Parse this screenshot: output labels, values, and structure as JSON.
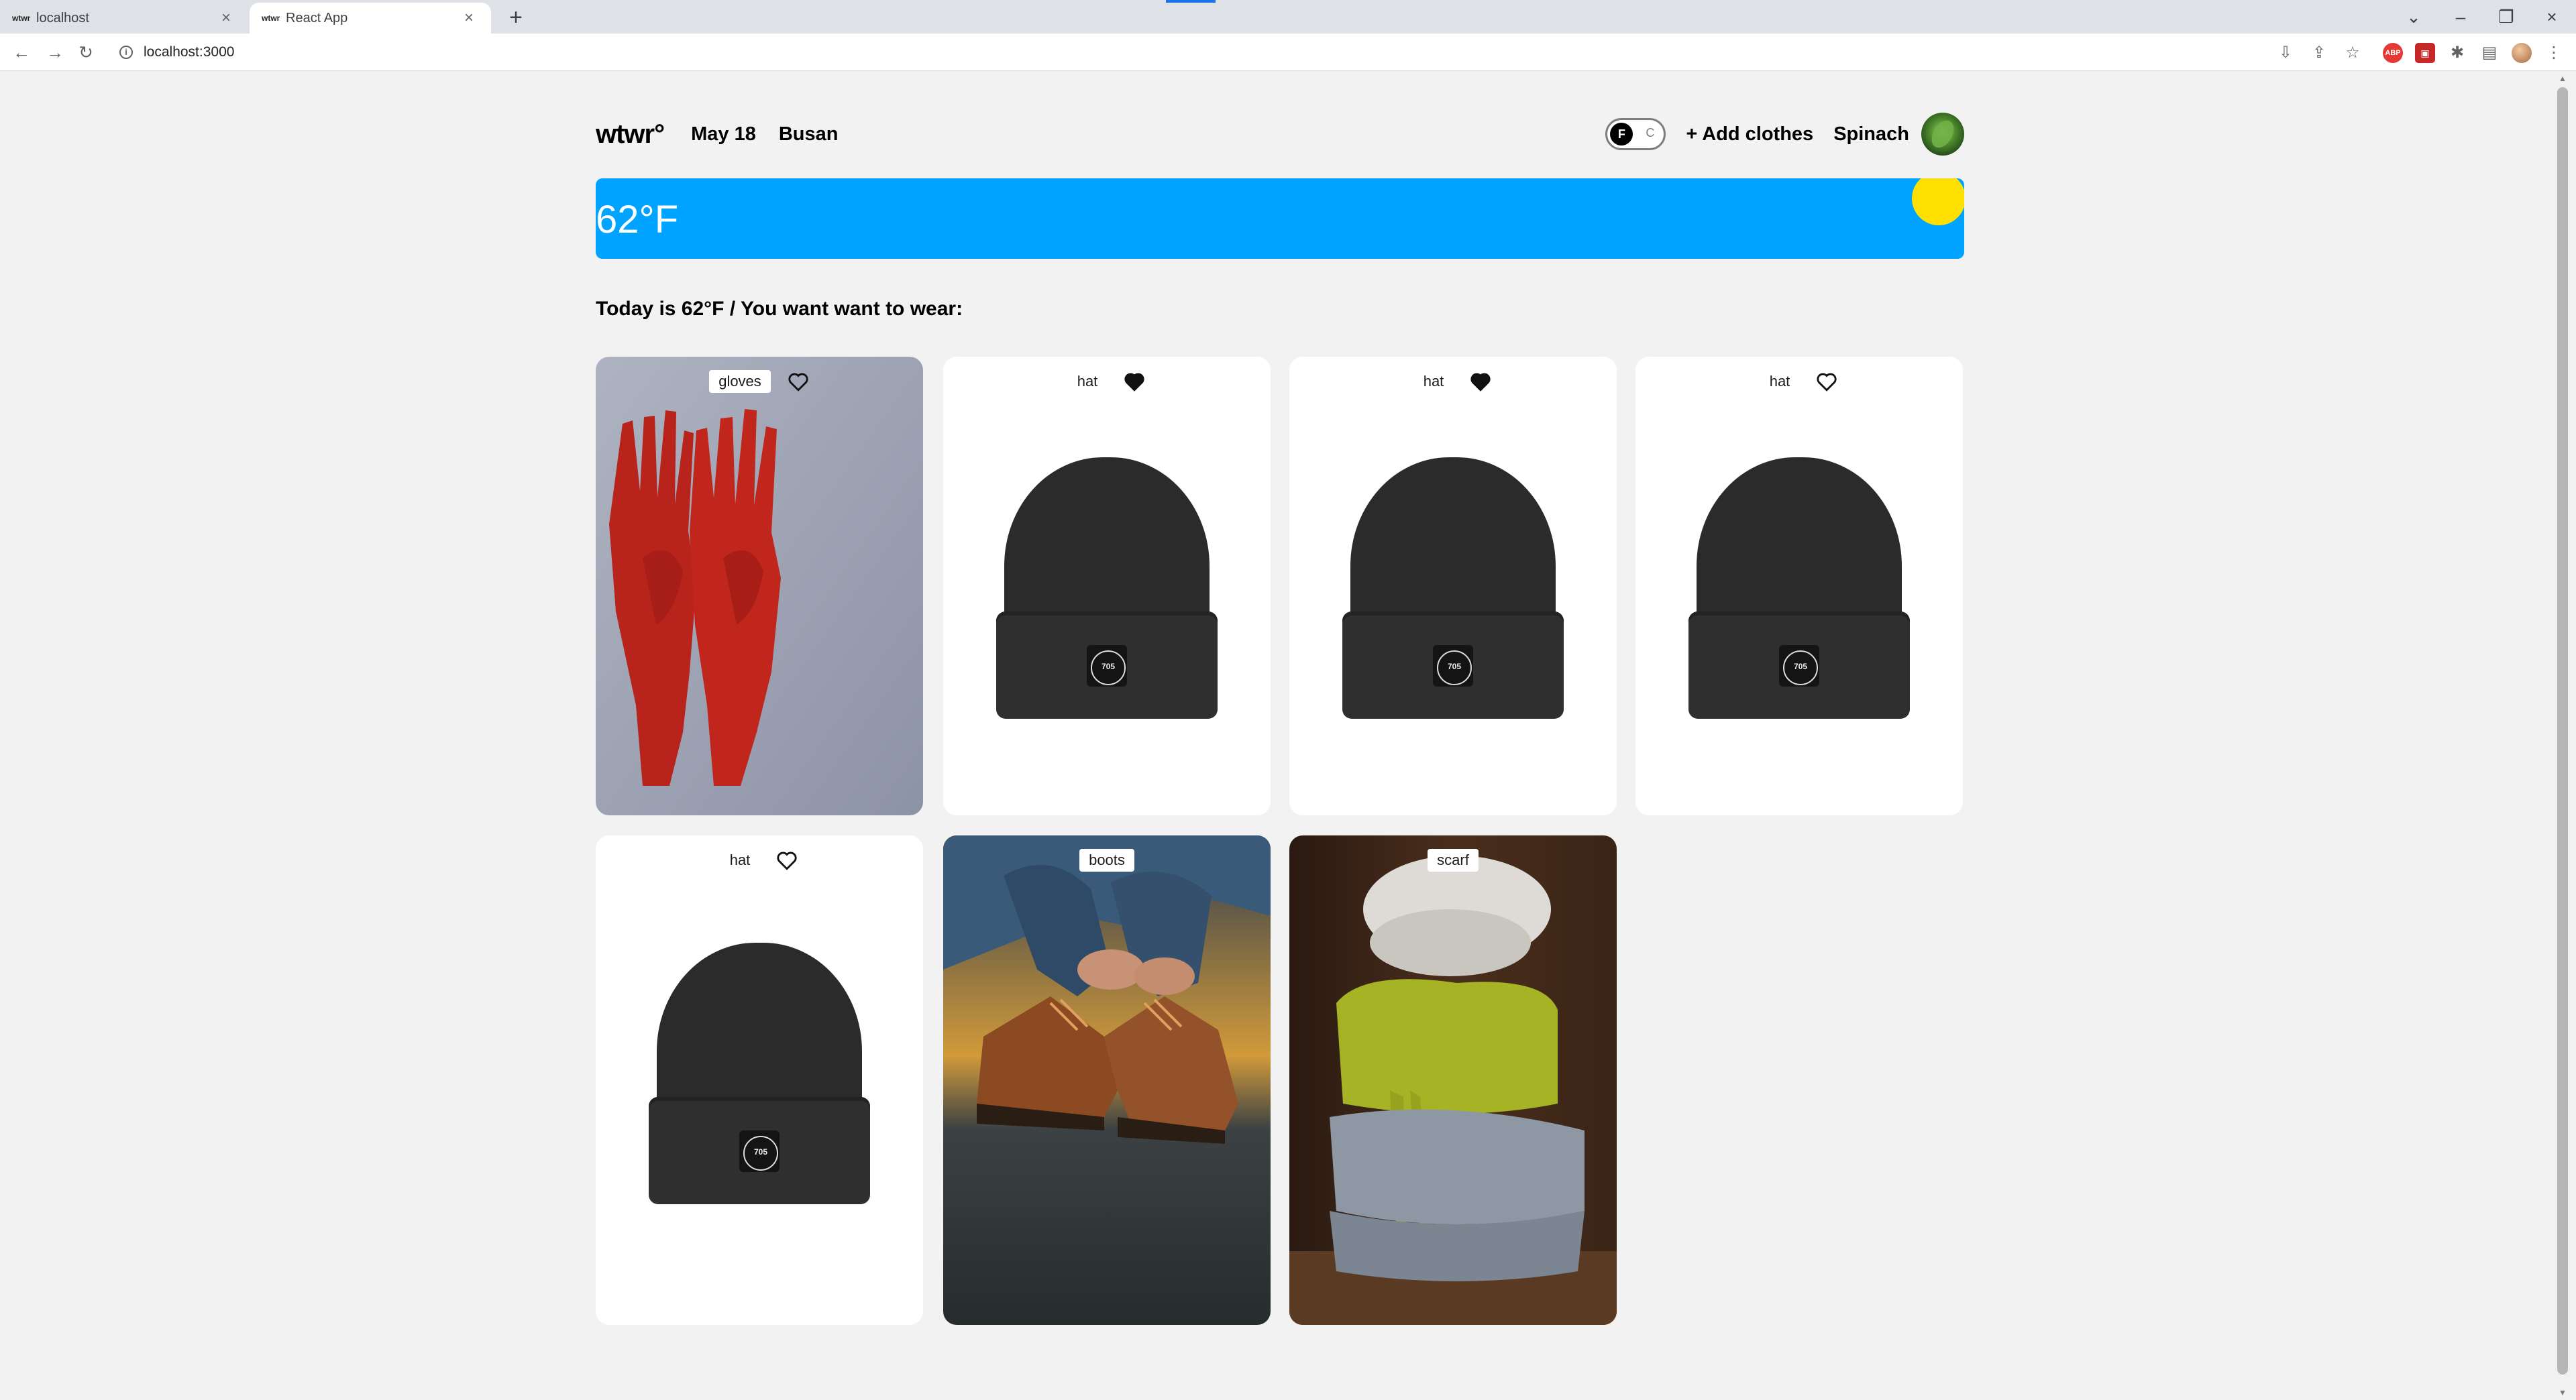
{
  "browser": {
    "tabs": [
      {
        "title": "localhost",
        "active": false
      },
      {
        "title": "React App",
        "active": true
      }
    ],
    "url": "localhost:3000"
  },
  "header": {
    "logo": "wtwr°",
    "date": "May 18",
    "city": "Busan",
    "unit_on": "F",
    "unit_off": "C",
    "add_clothes": "+ Add clothes",
    "username": "Spinach"
  },
  "weather": {
    "temperature": "62°F",
    "colors": {
      "sky": "#00a3ff",
      "sun": "#ffe000"
    }
  },
  "main": {
    "today_text": "Today is 62°F / You want want to wear:"
  },
  "cards": [
    {
      "name": "gloves",
      "liked": false
    },
    {
      "name": "hat",
      "liked": true
    },
    {
      "name": "hat",
      "liked": true
    },
    {
      "name": "hat",
      "liked": false
    },
    {
      "name": "hat",
      "liked": false
    },
    {
      "name": "boots",
      "liked": false
    },
    {
      "name": "scarf",
      "liked": false
    }
  ]
}
